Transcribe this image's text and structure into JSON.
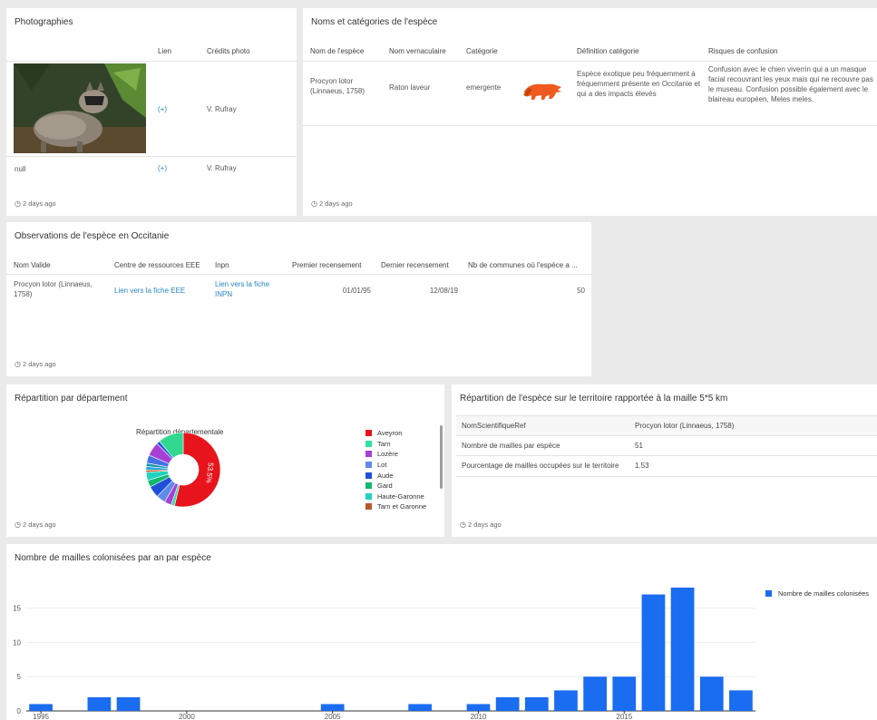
{
  "ago": "2 days ago",
  "photos": {
    "title": "Photographies",
    "headers": {
      "lien": "Lien",
      "credits": "Crédits photo"
    },
    "rows": [
      {
        "label": "",
        "link": "(+)",
        "credit": "V. Rufray"
      },
      {
        "label": "null",
        "link": "(+)",
        "credit": "V. Rufray"
      }
    ]
  },
  "names": {
    "title": "Noms et catégories de l'espèce",
    "headers": {
      "nom": "Nom de l'espèce",
      "vernaculaire": "Nom vernaculaire",
      "categorie": "Catégorie",
      "definition": "Définition catégorie",
      "risques": "Risques de confusion"
    },
    "row": {
      "nom": "Procyon lotor (Linnaeus, 1758)",
      "vernaculaire": "Raton laveur",
      "categorie": "emergente",
      "definition": "Espèce exotique peu fréquemment à fréquemment présente en Occitanie et qui a des impacts élevés",
      "risques": "Confusion avec le chien viverrin qui a un masque facial recouvrant les yeux mais qui ne recouvre pas le museau. Confusion possible également avec le blaireau européen, Meles meles."
    },
    "icon": "raccoon-icon",
    "icon_color": "#f05a1e"
  },
  "observations": {
    "title": "Observations de l'espèce en Occitanie",
    "headers": {
      "nom": "Nom Valide",
      "centre": "Centre de ressources EEE",
      "inpn": "Inpn",
      "premier": "Premier recensement",
      "dernier": "Dernier recensement",
      "communes": "Nb de communes où l'espèce a ..."
    },
    "row": {
      "nom": "Procyon lotor (Linnaeus, 1758)",
      "centre": "Lien vers la fiche EEE",
      "inpn": "Lien vers la fiche INPN",
      "premier": "01/01/95",
      "dernier": "12/08/19",
      "communes": "50"
    }
  },
  "departement": {
    "title": "Répartition par département",
    "chart_data": {
      "type": "pie",
      "title": "Répartition départementale",
      "legend_position": "right",
      "slices": [
        {
          "name": "Aveyron",
          "value": 53.5,
          "color": "#e8141c",
          "label": "53.5%"
        },
        {
          "name": "Tarn",
          "value": 1.5,
          "color": "#2ee2a2",
          "label": ""
        },
        {
          "name": "Lozère",
          "value": 3.0,
          "color": "#a63fd6",
          "label": ""
        },
        {
          "name": "Lot",
          "value": 4.0,
          "color": "#5f8ae8",
          "label": ""
        },
        {
          "name": "Aude",
          "value": 5.0,
          "color": "#1f4fd8",
          "label": ""
        },
        {
          "name": "Gard",
          "value": 3.0,
          "color": "#11b870",
          "label": ""
        },
        {
          "name": "Haute-Garonne",
          "value": 3.5,
          "color": "#1fd3c0",
          "label": ""
        },
        {
          "name": "Tarn et Garonne",
          "value": 1.0,
          "color": "#b8592a",
          "label": ""
        },
        {
          "name": "",
          "value": 1.5,
          "color": "#26a6e0",
          "label": ""
        },
        {
          "name": "",
          "value": 1.5,
          "color": "#1e96a8",
          "label": ""
        },
        {
          "name": "",
          "value": 3.5,
          "color": "#4470e6",
          "label": ""
        },
        {
          "name": "",
          "value": 6.0,
          "color": "#a63fd6",
          "label": ""
        },
        {
          "name": "",
          "value": 1.5,
          "color": "#2257dc",
          "label": ""
        },
        {
          "name": "",
          "value": 11.0,
          "color": "#30d890",
          "label": ""
        }
      ]
    }
  },
  "repartition": {
    "title": "Répartition de l'espèce sur le territoire rapportée à la maille 5*5 km",
    "rows": [
      {
        "key": "NomScientifiqueRef",
        "value": "Procyon lotor (Linnaeus, 1758)"
      },
      {
        "key": "Nombre de mailles par espèce",
        "value": "51"
      },
      {
        "key": "Pourcentage de mailles occupées sur le territoire",
        "value": "1.53"
      }
    ]
  },
  "mailles": {
    "title": "Nombre de mailles colonisées par an par espèce",
    "chart_data": {
      "type": "bar",
      "series": [
        {
          "name": "Nombre de mailles colonisées",
          "color": "#1a6cf0",
          "x": [
            1995,
            1997,
            1998,
            2005,
            2008,
            2010,
            2011,
            2012,
            2013,
            2014,
            2015,
            2016,
            2017,
            2018,
            2019
          ],
          "values": [
            1,
            2,
            2,
            1,
            1,
            1,
            2,
            2,
            3,
            5,
            5,
            17,
            18,
            5,
            3
          ]
        }
      ],
      "xlim": [
        1995,
        2019
      ],
      "x_ticks": [
        1995,
        2000,
        2005,
        2010,
        2015
      ],
      "ylim": [
        0,
        18
      ],
      "y_ticks": [
        0,
        5,
        10,
        15
      ],
      "legend_position": "top-right",
      "xlabel": "",
      "ylabel": ""
    }
  }
}
